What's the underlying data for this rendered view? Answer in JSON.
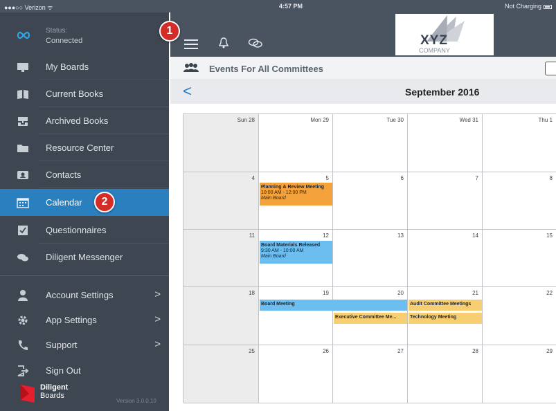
{
  "statusbar": {
    "carrier": "●●●○○ Verizon ᯤ",
    "time": "4:57 PM",
    "charging": "Not Charging"
  },
  "sidebar": {
    "status_label": "Status:",
    "status_value": "Connected",
    "items": [
      {
        "label": "My Boards",
        "icon": "boards-icon"
      },
      {
        "label": "Current Books",
        "icon": "book-icon"
      },
      {
        "label": "Archived Books",
        "icon": "archive-icon"
      },
      {
        "label": "Resource Center",
        "icon": "folder-icon"
      },
      {
        "label": "Contacts",
        "icon": "contacts-icon"
      },
      {
        "label": "Calendar",
        "icon": "calendar-icon"
      },
      {
        "label": "Questionnaires",
        "icon": "questionnaire-icon"
      },
      {
        "label": "Diligent Messenger",
        "icon": "messenger-icon"
      }
    ],
    "settings": [
      {
        "label": "Account Settings",
        "icon": "user-icon"
      },
      {
        "label": "App Settings",
        "icon": "gear-icon"
      },
      {
        "label": "Support",
        "icon": "phone-icon"
      },
      {
        "label": "Sign Out",
        "icon": "sign-out-icon"
      }
    ],
    "brand_name": "Diligent",
    "brand_sub": "Boards",
    "version": "Version 3.0.0.10"
  },
  "header": {
    "logo_text": "XYZ",
    "logo_sub": "COMPANY"
  },
  "events": {
    "title": "Events For All Committees"
  },
  "calendar": {
    "month": "September 2016",
    "headers": [
      "Sun 28",
      "Mon 29",
      "Tue 30",
      "Wed 31",
      "Thu 1"
    ],
    "rows": [
      [
        "4",
        "5",
        "6",
        "7",
        "8"
      ],
      [
        "11",
        "12",
        "13",
        "14",
        "15"
      ],
      [
        "18",
        "19",
        "20",
        "21",
        "22"
      ],
      [
        "25",
        "26",
        "27",
        "28",
        "29"
      ]
    ],
    "events": {
      "planning": {
        "title": "Planning & Review Meeting",
        "time": "10:00 AM - 12:00 PM",
        "location": "Main Board"
      },
      "materials": {
        "title": "Board Materials Released",
        "time": "9:30 AM - 10:00 AM",
        "location": "Main Board"
      },
      "board_meeting": {
        "title": "Board Meeting"
      },
      "executive": {
        "title": "Executive Committee Me..."
      },
      "audit": {
        "title": "Audit Committee Meetings"
      },
      "technology": {
        "title": "Technology Meeting"
      }
    }
  },
  "callouts": {
    "one": "1",
    "two": "2"
  },
  "colors": {
    "sidebar": "#3e4651",
    "active": "#2a7fbf",
    "orange": "#f4a23c",
    "blue": "#6cbdf0",
    "yellow": "#f8ce73",
    "badge": "#d42d27"
  }
}
